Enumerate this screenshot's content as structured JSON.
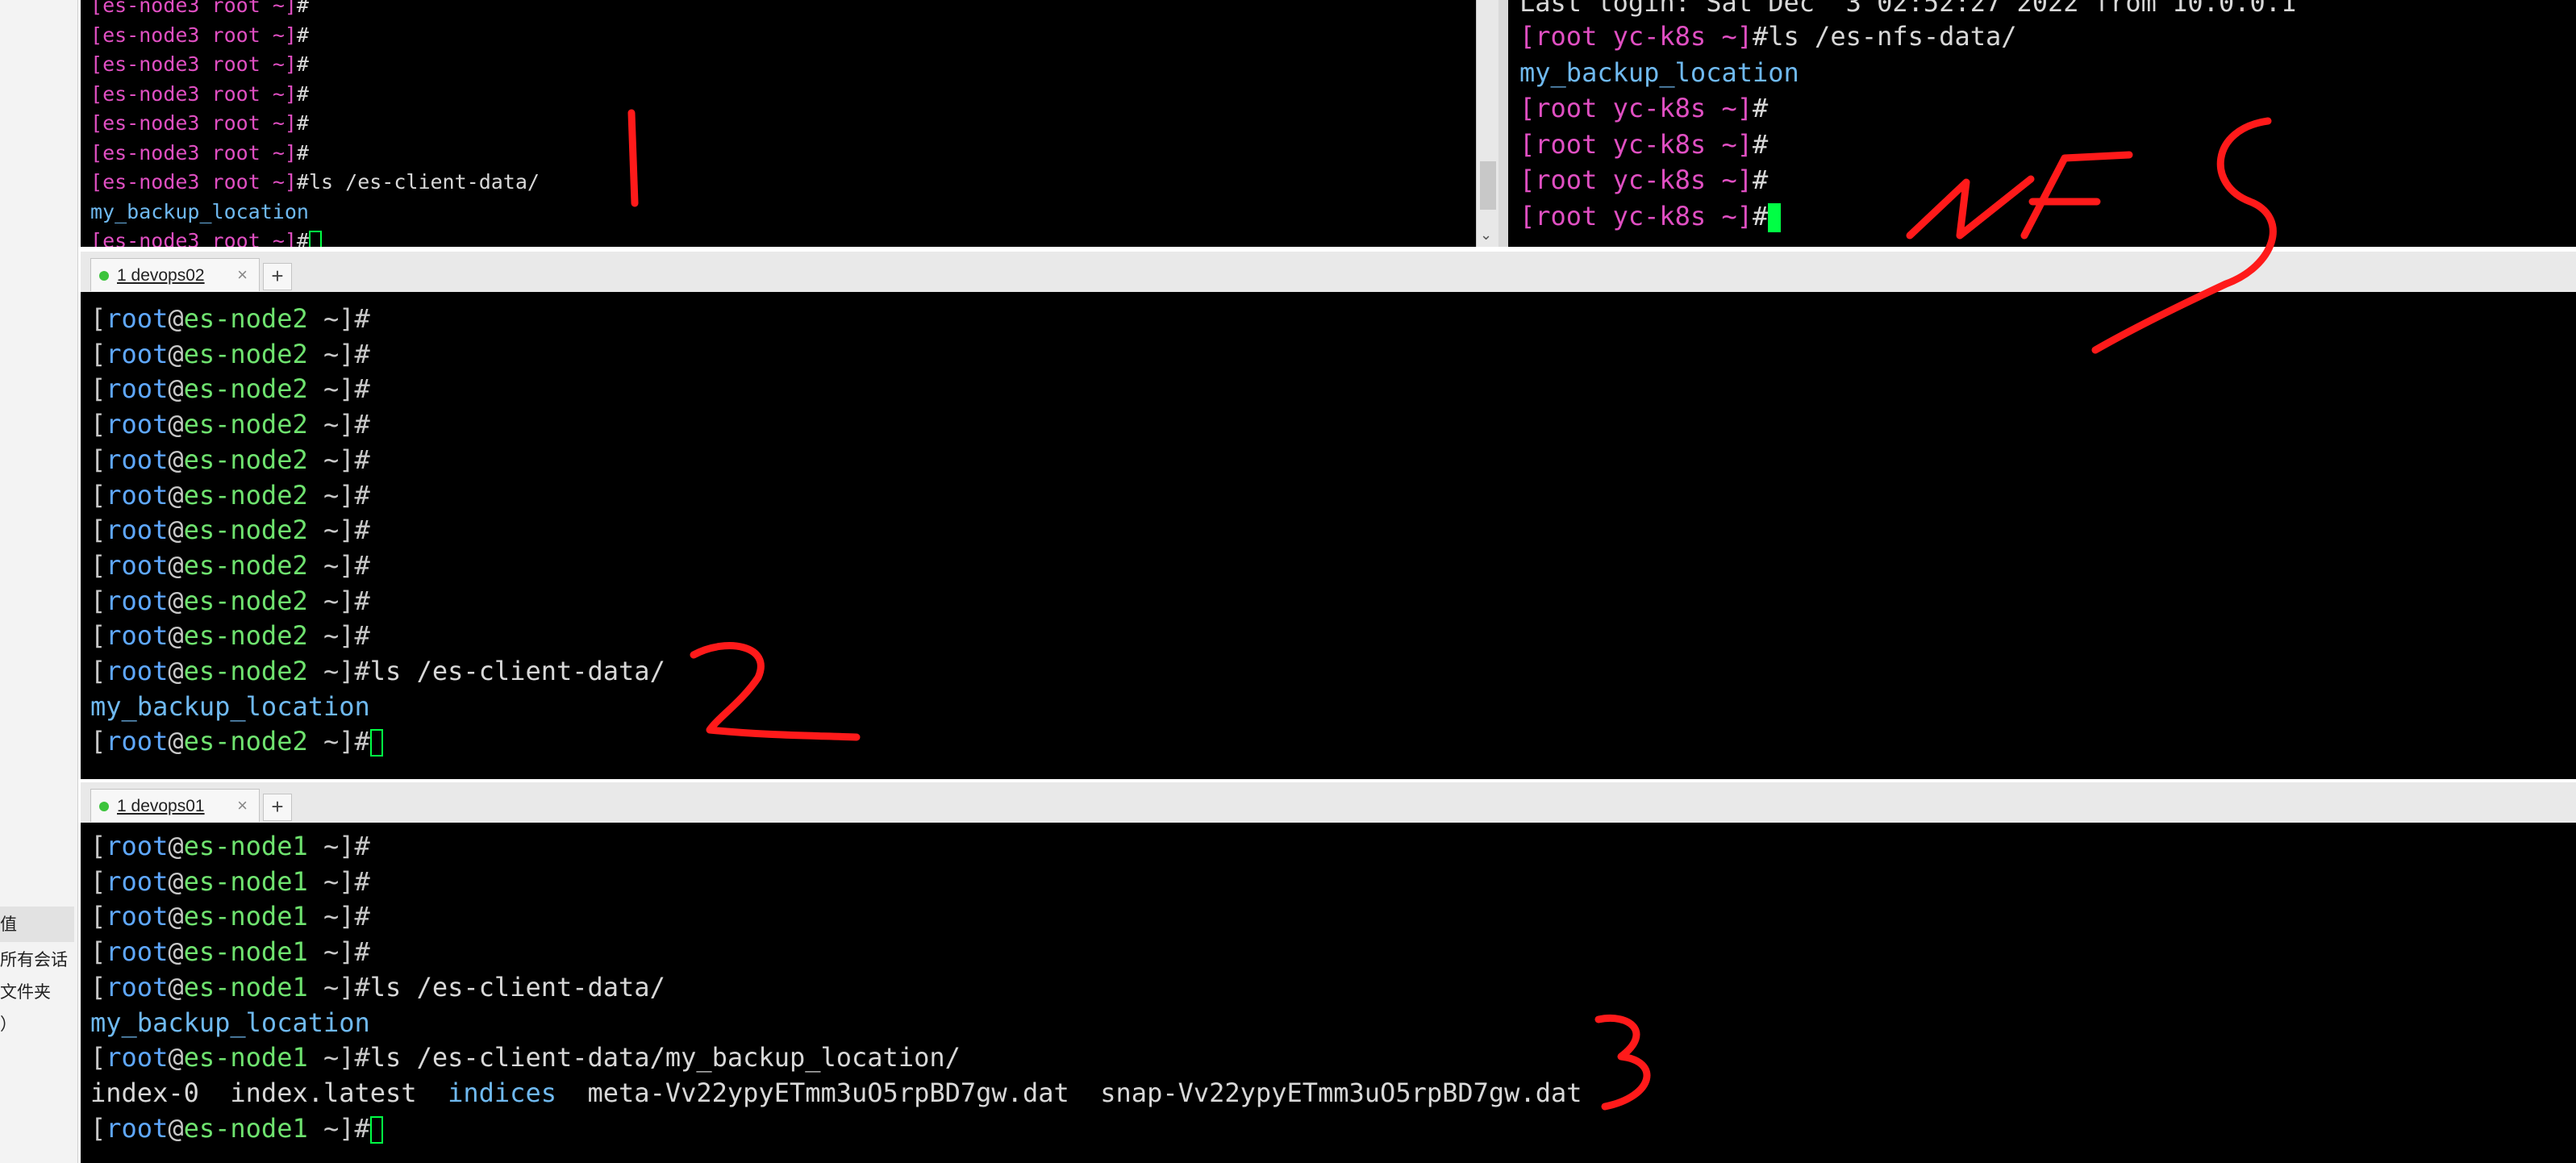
{
  "sidebar": {
    "items": [
      "值",
      "所有会话",
      "文件夹",
      "）"
    ]
  },
  "pane1": {
    "prompt_host": "es-node3",
    "prompt_user": "root",
    "lines": [
      {
        "type": "prompt",
        "cmd": ""
      },
      {
        "type": "prompt",
        "cmd": ""
      },
      {
        "type": "prompt",
        "cmd": ""
      },
      {
        "type": "prompt",
        "cmd": ""
      },
      {
        "type": "prompt",
        "cmd": ""
      },
      {
        "type": "prompt",
        "cmd": ""
      },
      {
        "type": "prompt",
        "cmd": "ls /es-client-data/"
      },
      {
        "type": "output",
        "text": "my_backup_location"
      },
      {
        "type": "prompt",
        "cmd": "",
        "cursor": true
      }
    ]
  },
  "pane_nfs": {
    "header": "Last login: Sat Dec  3 02:52:27 2022 from 10.0.0.1",
    "prompt_user": "root",
    "prompt_host": "yc-k8s",
    "lines": [
      {
        "type": "prompt",
        "cmd": "ls /es-nfs-data/"
      },
      {
        "type": "output",
        "text": "my_backup_location"
      },
      {
        "type": "prompt",
        "cmd": ""
      },
      {
        "type": "prompt",
        "cmd": ""
      },
      {
        "type": "prompt",
        "cmd": ""
      },
      {
        "type": "prompt",
        "cmd": "",
        "cursor": true
      }
    ]
  },
  "tab_devops02": {
    "label": "1 devops02",
    "close": "×",
    "add": "+"
  },
  "pane2": {
    "prompt_user": "root",
    "prompt_host": "es-node2",
    "lines": [
      {
        "type": "prompt",
        "cmd": ""
      },
      {
        "type": "prompt",
        "cmd": ""
      },
      {
        "type": "prompt",
        "cmd": ""
      },
      {
        "type": "prompt",
        "cmd": ""
      },
      {
        "type": "prompt",
        "cmd": ""
      },
      {
        "type": "prompt",
        "cmd": ""
      },
      {
        "type": "prompt",
        "cmd": ""
      },
      {
        "type": "prompt",
        "cmd": ""
      },
      {
        "type": "prompt",
        "cmd": ""
      },
      {
        "type": "prompt",
        "cmd": ""
      },
      {
        "type": "prompt",
        "cmd": "ls /es-client-data/"
      },
      {
        "type": "output",
        "text": "my_backup_location"
      },
      {
        "type": "prompt",
        "cmd": "",
        "cursor": true
      }
    ]
  },
  "tab_devops01": {
    "label": "1 devops01",
    "close": "×",
    "add": "+"
  },
  "pane3": {
    "prompt_user": "root",
    "prompt_host": "es-node1",
    "lines": [
      {
        "type": "prompt",
        "cmd": ""
      },
      {
        "type": "prompt",
        "cmd": ""
      },
      {
        "type": "prompt",
        "cmd": ""
      },
      {
        "type": "prompt",
        "cmd": ""
      },
      {
        "type": "prompt",
        "cmd": "ls /es-client-data/"
      },
      {
        "type": "output",
        "text": "my_backup_location"
      },
      {
        "type": "prompt",
        "cmd": "ls /es-client-data/my_backup_location/"
      },
      {
        "type": "listing",
        "items": [
          {
            "text": "index-0",
            "dir": false
          },
          {
            "text": "index.latest",
            "dir": false
          },
          {
            "text": "indices",
            "dir": true
          },
          {
            "text": "meta-Vv22ypyETmm3uO5rpBD7gw.dat",
            "dir": false
          },
          {
            "text": "snap-Vv22ypyETmm3uO5rpBD7gw.dat",
            "dir": false
          }
        ]
      },
      {
        "type": "prompt",
        "cmd": "",
        "cursor": true
      }
    ]
  },
  "annotations": {
    "pane1": "1",
    "nfs": "NFS",
    "pane2": "2",
    "pane3": "3",
    "color": "#ff1a1a"
  },
  "colors": {
    "terminal_bg": "#000000",
    "prompt_user": "#5fa8ff",
    "prompt_host": "#6fe36f",
    "dir_listing": "#6fb9f0",
    "magenta_prompt": "#e04fc2",
    "cursor_green": "#00ff44"
  }
}
